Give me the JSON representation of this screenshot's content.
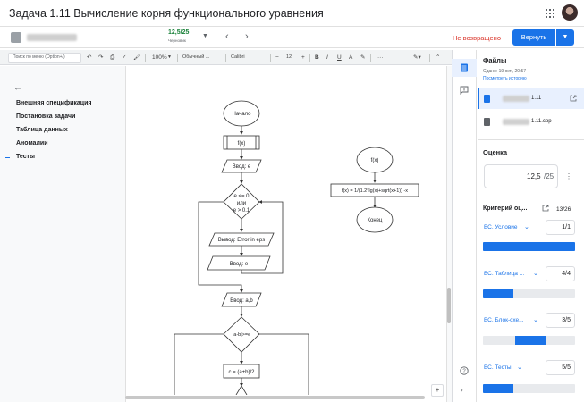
{
  "header": {
    "title": "Задача 1.11 Вычисление корня функционального уравнения"
  },
  "grading_bar": {
    "grade": "12,5/25",
    "grade_status": "Черновик",
    "not_returned": "Не возвращено",
    "return_label": "Вернуть"
  },
  "toolbar": {
    "menu_search_placeholder": "Поиск по меню (Option+/)",
    "zoom": "100%",
    "style": "Обычный ...",
    "font": "Calibri",
    "font_size": "12"
  },
  "outline": {
    "items": [
      {
        "label": "Внешняя спецификация"
      },
      {
        "label": "Постановка задачи"
      },
      {
        "label": "Таблица данных"
      },
      {
        "label": "Аномалии"
      },
      {
        "label": "Тесты"
      }
    ],
    "active": "Тесты"
  },
  "flowchart": {
    "start": "Начало",
    "call": "f(x)",
    "input_e": "Ввод: e",
    "cond_e": [
      "e <= 0",
      "или",
      "e > 0.1"
    ],
    "error": "Вывод: Error in eps",
    "input_e2": "Ввод: e",
    "input_ab": "Ввод: a,b",
    "cond_ab": "|a-b|>=e",
    "calc_c": "c = (a+b)/2",
    "func_start": "f(x)",
    "func_body": "f(x) = 1/(1.2*lg(x)+sqrt(x+1)) -x",
    "func_end": "Конец"
  },
  "side_panel": {
    "files_title": "Файлы",
    "submitted": "Сдано: 19 окт., 20:57",
    "history_link": "Посмотреть историю",
    "files": [
      {
        "name": "1.11"
      },
      {
        "name": "1.11.cpp"
      }
    ],
    "grade_title": "Оценка",
    "grade_score": "12,5",
    "grade_max": "/25",
    "rubric_title": "Критерий оц...",
    "rubric_total": "13/26",
    "criteria": [
      {
        "label": "ВС. Условие",
        "score": "1/1",
        "fill": 1.0
      },
      {
        "label": "ВС. Таблица ...",
        "score": "4/4",
        "fill": 0.33
      },
      {
        "label": "ВС. Блок-схе...",
        "score": "3/5",
        "fill": 0.33
      },
      {
        "label": "ВС. Тесты",
        "score": "5/5",
        "fill": 0.33
      }
    ]
  },
  "icons": {
    "apps": "apps-grid-icon",
    "avatar": "user-avatar",
    "files": "files-icon",
    "comments": "comment-icon",
    "help": "help-icon"
  },
  "colors": {
    "accent": "#1a73e8",
    "grade_green": "#188038",
    "not_returned_red": "#d93025"
  }
}
